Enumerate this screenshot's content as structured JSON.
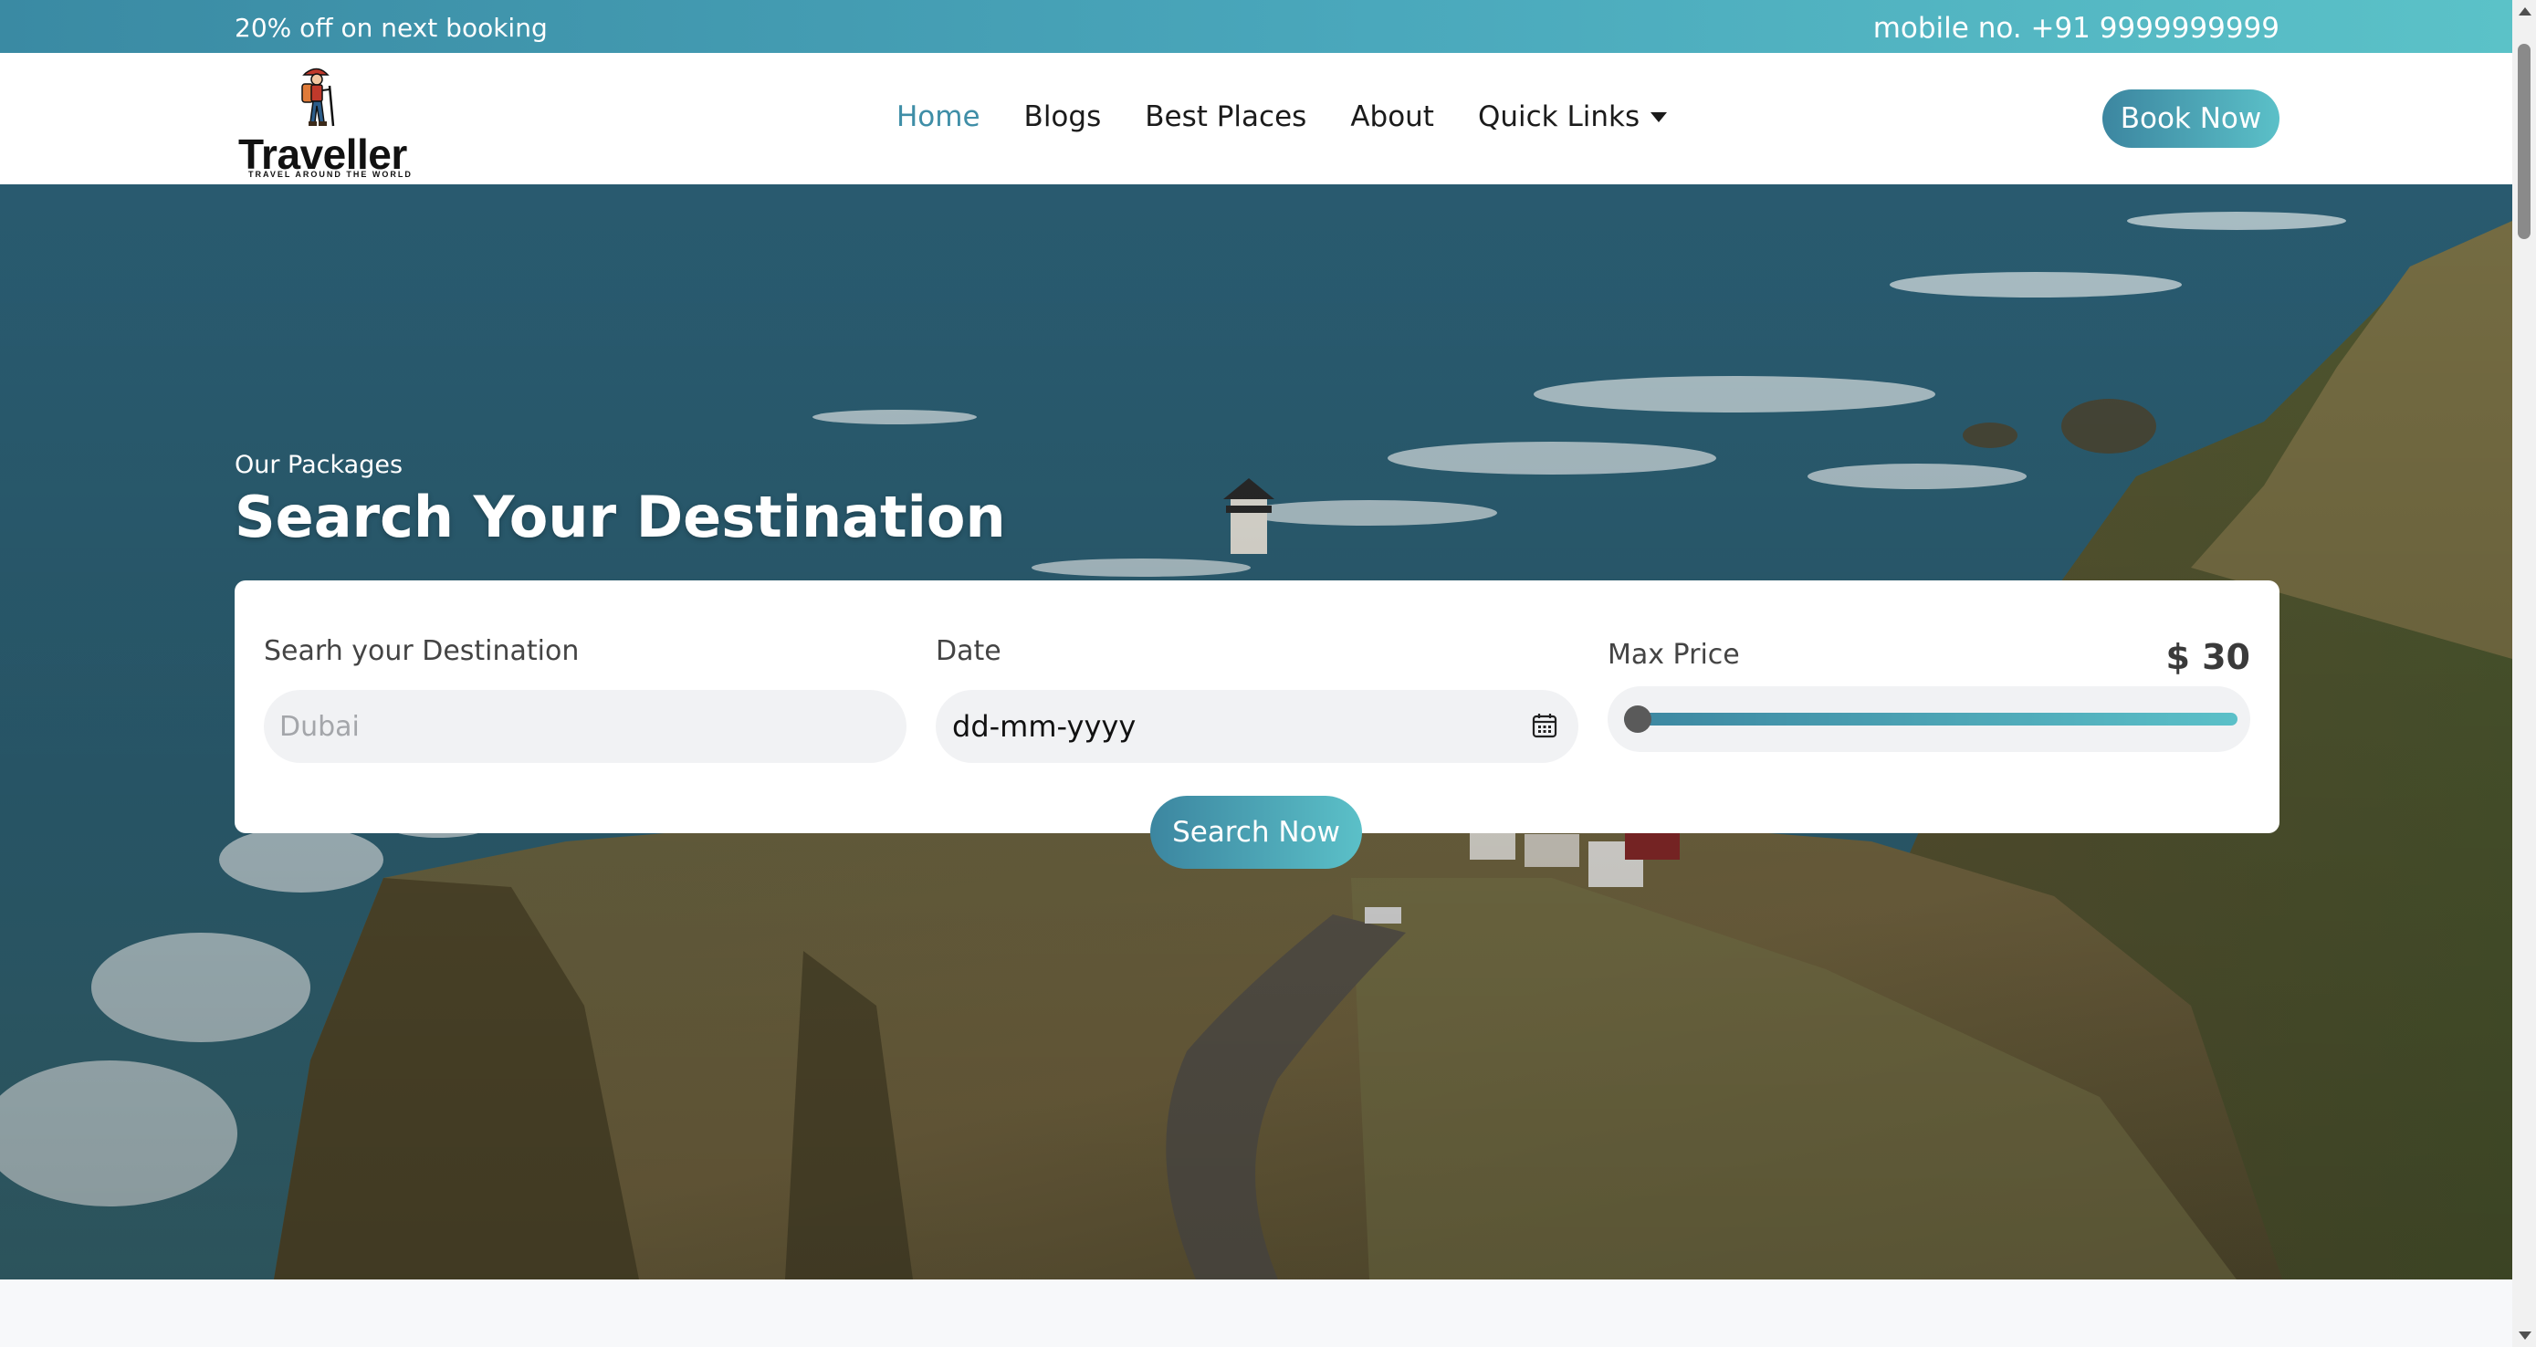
{
  "topbar": {
    "promo": "20% off on next booking",
    "phone": "mobile no. +91 9999999999"
  },
  "logo": {
    "name": "Traveller",
    "tagline": "TRAVEL AROUND THE WORLD",
    "icon": "hiker-icon"
  },
  "nav": {
    "items": [
      {
        "label": "Home",
        "active": true
      },
      {
        "label": "Blogs",
        "active": false
      },
      {
        "label": "Best Places",
        "active": false
      },
      {
        "label": "About",
        "active": false
      },
      {
        "label": "Quick Links",
        "active": false,
        "dropdown": true
      }
    ],
    "book_label": "Book Now"
  },
  "hero": {
    "subtitle": "Our Packages",
    "title": "Search Your Destination",
    "background": "aerial-coastline-lighthouse"
  },
  "search": {
    "destination": {
      "label": "Searh your Destination",
      "placeholder": "Dubai",
      "value": ""
    },
    "date": {
      "label": "Date",
      "value": "dd-mm-yyyy",
      "icon": "calendar-icon"
    },
    "price": {
      "label": "Max Price",
      "value": "$ 30",
      "slider_level": 0
    },
    "button_label": "Search Now"
  },
  "colors": {
    "accent_start": "#3c86a0",
    "accent_end": "#5bc0c8",
    "active_nav": "#3f8ea7"
  }
}
